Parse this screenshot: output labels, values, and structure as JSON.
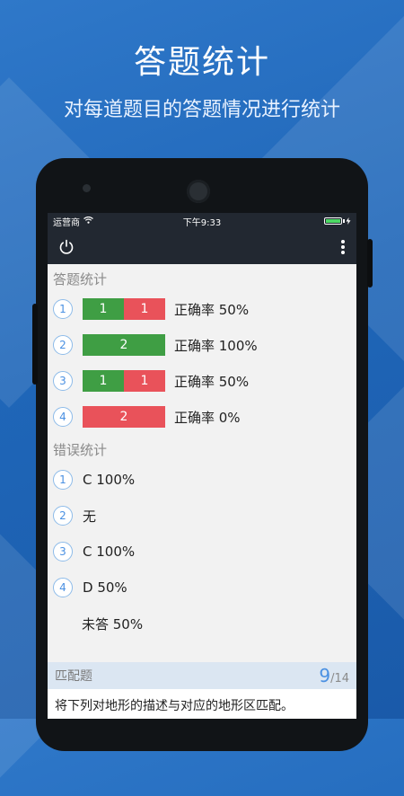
{
  "hero": {
    "title": "答题统计",
    "subtitle": "对每道题目的答题情况进行统计"
  },
  "status_bar": {
    "carrier": "运营商",
    "time": "下午9:33",
    "wifi_icon": "wifi-icon",
    "battery_icon": "battery-icon",
    "battery_level": 1.0
  },
  "toolbar": {
    "power_icon": "power-icon",
    "more_icon": "more-vertical-icon"
  },
  "answer_stats": {
    "title": "答题统计",
    "items": [
      {
        "number": "1",
        "correct": "1",
        "wrong": "1",
        "rate": "正确率 50%"
      },
      {
        "number": "2",
        "correct": "2",
        "wrong": "",
        "rate": "正确率 100%"
      },
      {
        "number": "3",
        "correct": "1",
        "wrong": "1",
        "rate": "正确率 50%"
      },
      {
        "number": "4",
        "correct": "",
        "wrong": "2",
        "rate": "正确率 0%"
      }
    ]
  },
  "error_stats": {
    "title": "错误统计",
    "items": [
      {
        "number": "1",
        "text": "C 100%"
      },
      {
        "number": "2",
        "text": "无"
      },
      {
        "number": "3",
        "text": "C 100%"
      },
      {
        "number": "4",
        "text": "D 50%"
      },
      {
        "number": "",
        "text": "未答 50%"
      }
    ]
  },
  "footer": {
    "question_type": "匹配题",
    "current": "9",
    "total": "/14",
    "question_text": "将下列对地形的描述与对应的地形区匹配。"
  },
  "colors": {
    "correct": "#3f9e44",
    "wrong": "#e9525a",
    "accent": "#4a90e2",
    "app_bar": "#222831"
  }
}
